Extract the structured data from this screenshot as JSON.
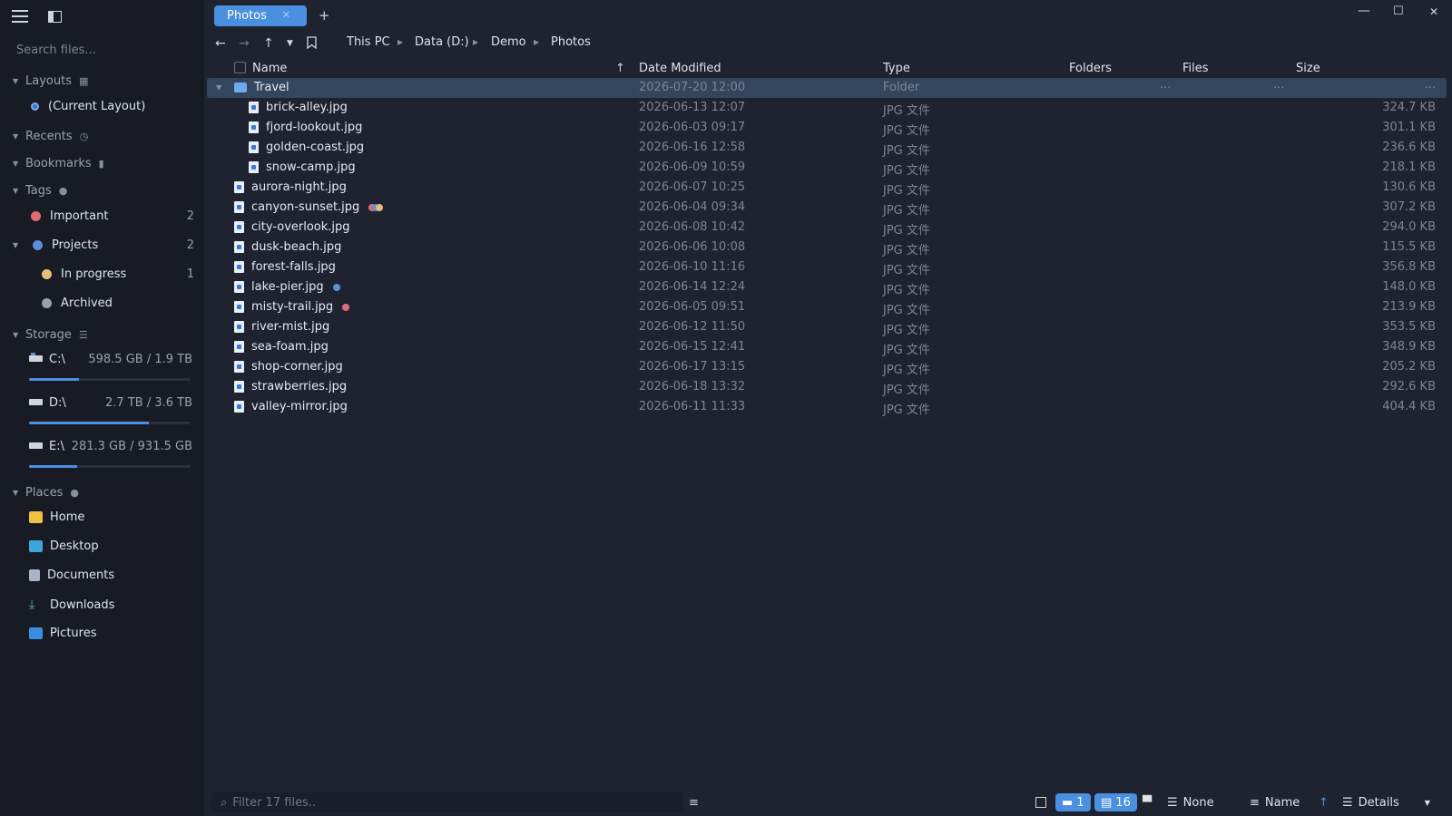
{
  "colors": {
    "accent": "#4a8fe0",
    "tag_important": "#e06c75",
    "tag_projects": "#5b8fe0",
    "tag_in_progress": "#e5c07b",
    "tag_archived": "#9aa1ae"
  },
  "sidebar": {
    "search_placeholder": "Search files...",
    "layouts_label": "Layouts",
    "current_layout": "(Current Layout)",
    "recents_label": "Recents",
    "bookmarks_label": "Bookmarks",
    "tags_label": "Tags",
    "tags": [
      {
        "label": "Important",
        "count": "2"
      },
      {
        "label": "Projects",
        "count": "2"
      },
      {
        "label": "In progress",
        "count": "1"
      },
      {
        "label": "Archived",
        "count": ""
      }
    ],
    "storage_label": "Storage",
    "drives": [
      {
        "name": "C:\\",
        "size": "598.5 GB / 1.9 TB",
        "used_fraction": 0.31
      },
      {
        "name": "D:\\",
        "size": "2.7 TB / 3.6 TB",
        "used_fraction": 0.74
      },
      {
        "name": "E:\\",
        "size": "281.3 GB / 931.5 GB",
        "used_fraction": 0.3
      }
    ],
    "places_label": "Places",
    "places": [
      {
        "label": "Home",
        "icon": "folder-icon"
      },
      {
        "label": "Desktop",
        "icon": "desktop-icon"
      },
      {
        "label": "Documents",
        "icon": "documents-icon"
      },
      {
        "label": "Downloads",
        "icon": "download-icon"
      },
      {
        "label": "Pictures",
        "icon": "pictures-icon"
      }
    ]
  },
  "tabs": [
    {
      "label": "Photos"
    }
  ],
  "tab_add": "+",
  "breadcrumb": [
    "This PC",
    "Data (D:)",
    "Demo",
    "Photos"
  ],
  "columns": {
    "name": "Name",
    "date": "Date Modified",
    "type": "Type",
    "folders": "Folders",
    "files": "Files",
    "size": "Size"
  },
  "rows": [
    {
      "name": "Travel",
      "date": "2026-07-20 12:00",
      "type": "Folder",
      "folders": "...",
      "files": "...",
      "size": "..."
    },
    {
      "name": "brick-alley.jpg",
      "date": "2026-06-13 12:07",
      "type": "JPG 文件",
      "size": "324.7 KB"
    },
    {
      "name": "fjord-lookout.jpg",
      "date": "2026-06-03 09:17",
      "type": "JPG 文件",
      "size": "301.1 KB"
    },
    {
      "name": "golden-coast.jpg",
      "date": "2026-06-16 12:58",
      "type": "JPG 文件",
      "size": "236.6 KB"
    },
    {
      "name": "snow-camp.jpg",
      "date": "2026-06-09 10:59",
      "type": "JPG 文件",
      "size": "218.1 KB"
    },
    {
      "name": "aurora-night.jpg",
      "date": "2026-06-07 10:25",
      "type": "JPG 文件",
      "size": "130.6 KB"
    },
    {
      "name": "canyon-sunset.jpg",
      "date": "2026-06-04 09:34",
      "type": "JPG 文件",
      "size": "307.2 KB"
    },
    {
      "name": "city-overlook.jpg",
      "date": "2026-06-08 10:42",
      "type": "JPG 文件",
      "size": "294.0 KB"
    },
    {
      "name": "dusk-beach.jpg",
      "date": "2026-06-06 10:08",
      "type": "JPG 文件",
      "size": "115.5 KB"
    },
    {
      "name": "forest-falls.jpg",
      "date": "2026-06-10 11:16",
      "type": "JPG 文件",
      "size": "356.8 KB"
    },
    {
      "name": "lake-pier.jpg",
      "date": "2026-06-14 12:24",
      "type": "JPG 文件",
      "size": "148.0 KB"
    },
    {
      "name": "misty-trail.jpg",
      "date": "2026-06-05 09:51",
      "type": "JPG 文件",
      "size": "213.9 KB"
    },
    {
      "name": "river-mist.jpg",
      "date": "2026-06-12 11:50",
      "type": "JPG 文件",
      "size": "353.5 KB"
    },
    {
      "name": "sea-foam.jpg",
      "date": "2026-06-15 12:41",
      "type": "JPG 文件",
      "size": "348.9 KB"
    },
    {
      "name": "shop-corner.jpg",
      "date": "2026-06-17 13:15",
      "type": "JPG 文件",
      "size": "205.2 KB"
    },
    {
      "name": "strawberries.jpg",
      "date": "2026-06-18 13:32",
      "type": "JPG 文件",
      "size": "292.6 KB"
    },
    {
      "name": "valley-mirror.jpg",
      "date": "2026-06-11 11:33",
      "type": "JPG 文件",
      "size": "404.4 KB"
    }
  ],
  "status": {
    "filter_placeholder": "Filter 17 files..",
    "folder_count": "1",
    "file_count": "16",
    "group_by": "None",
    "sort_by": "Name",
    "view_mode": "Details"
  }
}
